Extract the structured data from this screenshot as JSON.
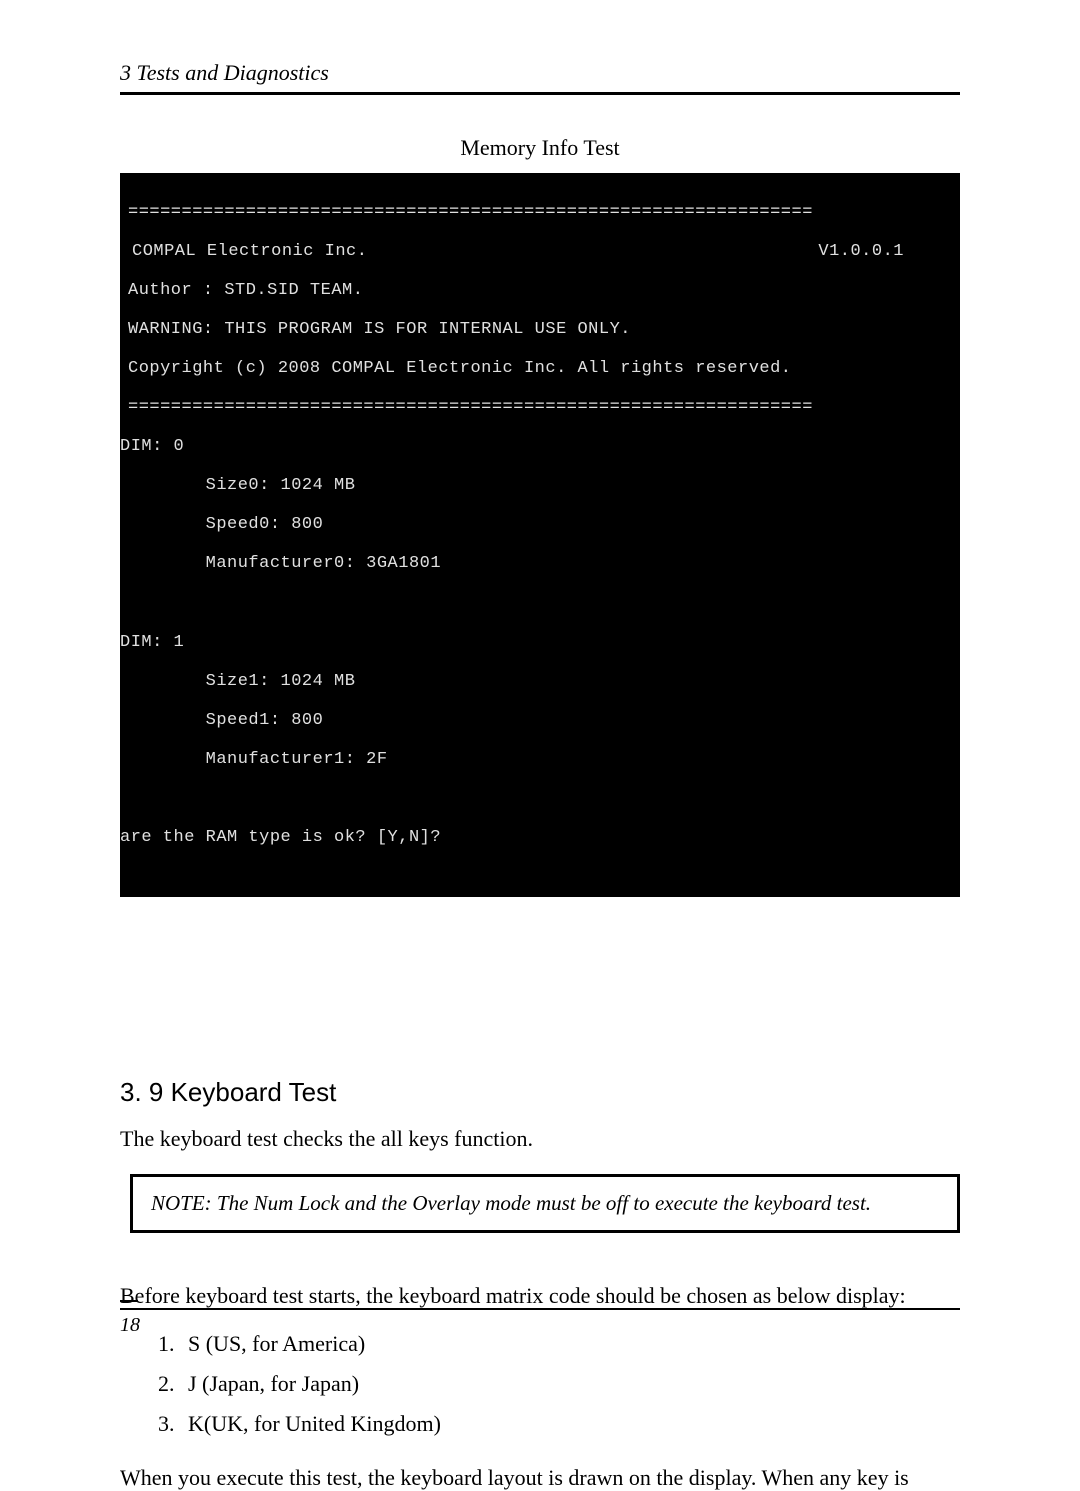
{
  "header": {
    "chapter": "3 Tests and Diagnostics"
  },
  "figure": {
    "title": "Memory Info Test"
  },
  "terminal": {
    "sep": "================================================================",
    "company": "COMPAL Electronic Inc.",
    "version": "V1.0.0.1",
    "author": "Author : STD.SID TEAM.",
    "warning": "WARNING: THIS PROGRAM IS FOR INTERNAL USE ONLY.",
    "copyright": "Copyright (c) 2008 COMPAL Electronic Inc. All rights reserved.",
    "dim0_label": "DIM: 0",
    "dim0_size": "        Size0: 1024 MB",
    "dim0_speed": "        Speed0: 800",
    "dim0_mfr": "        Manufacturer0: 3GA1801",
    "dim1_label": "DIM: 1",
    "dim1_size": "        Size1: 1024 MB",
    "dim1_speed": "        Speed1: 800",
    "dim1_mfr": "        Manufacturer1: 2F",
    "prompt": "are the RAM type is ok? [Y,N]?"
  },
  "section": {
    "title": "3. 9 Keyboard Test",
    "intro": "The keyboard test checks the all keys function.",
    "note": "NOTE:  The Num Lock and the Overlay mode must be off to execute the keyboard test.",
    "pre_list": "Before keyboard test starts, the keyboard matrix code should be chosen as below display:",
    "items": {
      "i1": "S (US, for America)",
      "i2": "J (Japan, for Japan)",
      "i3": "K(UK, for United Kingdom)"
    },
    "post_list": "When you execute this test, the keyboard layout is drawn on the display. When any key is"
  },
  "footer": {
    "page_number": "18"
  }
}
